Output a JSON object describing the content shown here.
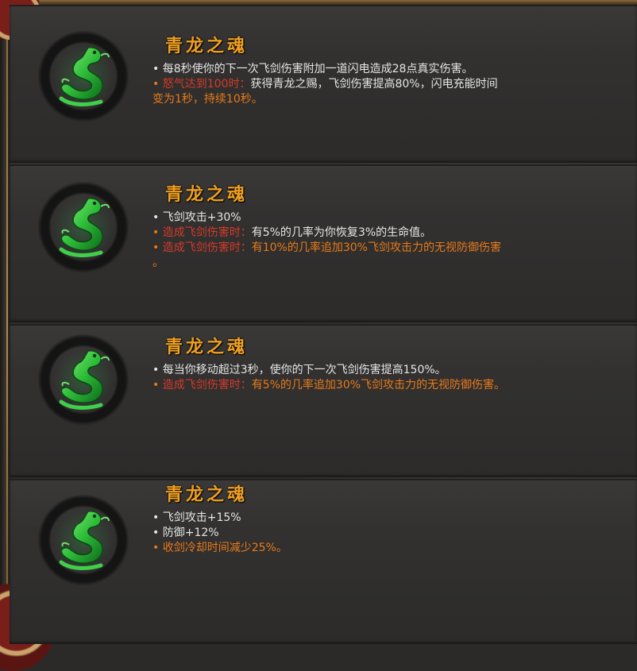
{
  "cards": [
    {
      "icon": "jade-dragon-icon",
      "title": "青龙之魂",
      "lines": [
        {
          "bullet": "•",
          "bullet_color": "w",
          "label": "",
          "text": "每8秒使你的下一次飞剑伤害附加一道闪电造成28点真实伤害。"
        },
        {
          "bullet": "•",
          "bullet_color": "o",
          "label": "怒气达到100时：",
          "text": "获得青龙之赐，飞剑伤害提高80%，闪电充能时间"
        },
        {
          "bullet": "",
          "bullet_color": "o",
          "label": "",
          "text": "变为1秒，持续10秒。",
          "text_color": "o"
        }
      ]
    },
    {
      "icon": "jade-dragon-icon",
      "title": "青龙之魂",
      "lines": [
        {
          "bullet": "•",
          "bullet_color": "w",
          "label": "",
          "text": "飞剑攻击+30%"
        },
        {
          "bullet": "•",
          "bullet_color": "o",
          "label": "造成飞剑伤害时：",
          "text": "有5%的几率为你恢复3%的生命值。",
          "text_color": "w"
        },
        {
          "bullet": "•",
          "bullet_color": "o",
          "label": "造成飞剑伤害时：",
          "text": "有10%的几率追加30%飞剑攻击力的无视防御伤害",
          "text_color": "o"
        },
        {
          "bullet": "",
          "bullet_color": "o",
          "label": "",
          "text": "。",
          "text_color": "o"
        }
      ]
    },
    {
      "icon": "jade-dragon-icon",
      "title": "青龙之魂",
      "lines": [
        {
          "bullet": "•",
          "bullet_color": "w",
          "label": "",
          "text": "每当你移动超过3秒，使你的下一次飞剑伤害提高150%。"
        },
        {
          "bullet": "•",
          "bullet_color": "o",
          "label": "造成飞剑伤害时：",
          "text": "有5%的几率追加30%飞剑攻击力的无视防御伤害。",
          "text_color": "o"
        }
      ]
    },
    {
      "icon": "jade-dragon-icon",
      "title": "青龙之魂",
      "lines": [
        {
          "bullet": "•",
          "bullet_color": "w",
          "label": "",
          "text": "飞剑攻击+15%"
        },
        {
          "bullet": "•",
          "bullet_color": "w",
          "label": "",
          "text": "防御+12%"
        },
        {
          "bullet": "•",
          "bullet_color": "o",
          "label": "",
          "text": "收剑冷却时间减少25%。",
          "text_color": "o"
        }
      ]
    }
  ]
}
